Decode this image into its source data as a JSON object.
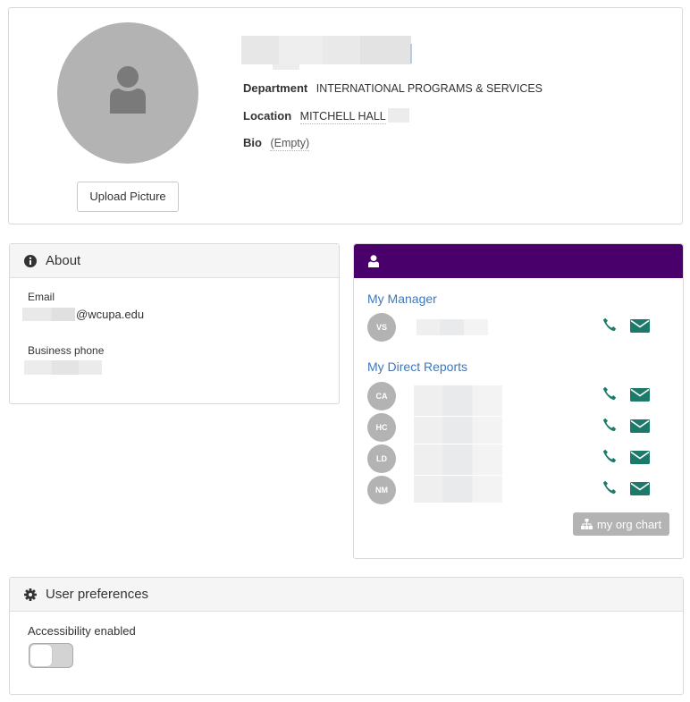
{
  "profile": {
    "upload_label": "Upload Picture",
    "department_label": "Department",
    "department_value": "INTERNATIONAL PROGRAMS & SERVICES",
    "location_label": "Location",
    "location_value": "MITCHELL HALL",
    "bio_label": "Bio",
    "bio_value": "(Empty)"
  },
  "about": {
    "title": "About",
    "email_label": "Email",
    "email_domain": "@wcupa.edu",
    "phone_label": "Business phone"
  },
  "org": {
    "manager_title": "My Manager",
    "manager": {
      "initials": "VS"
    },
    "reports_title": "My Direct Reports",
    "reports": [
      {
        "initials": "CA"
      },
      {
        "initials": "HC"
      },
      {
        "initials": "LD"
      },
      {
        "initials": "NM"
      }
    ],
    "org_chart_label": "my org chart"
  },
  "prefs": {
    "title": "User preferences",
    "accessibility_label": "Accessibility enabled",
    "accessibility_enabled": false
  },
  "colors": {
    "header_purple": "#49006a",
    "link_blue": "#3e78b9",
    "contact_green": "#1d7a6a",
    "avatar_gray": "#b3b3b3"
  }
}
